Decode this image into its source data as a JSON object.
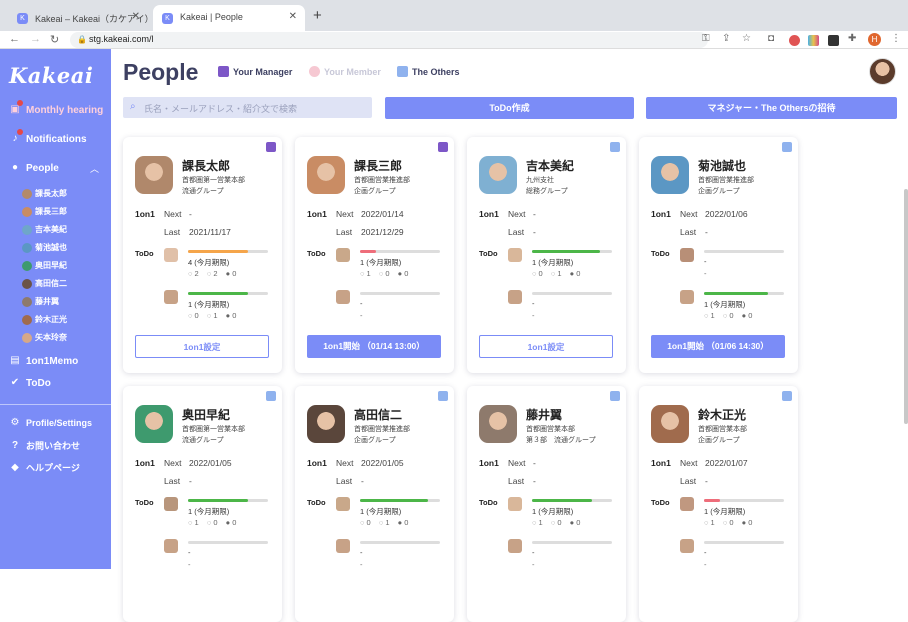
{
  "browser": {
    "tabs": [
      {
        "title": "Kakeai – Kakeai（カケアイ）| M..."
      },
      {
        "title": "Kakeai | People"
      }
    ],
    "url": "stg.kakeai.com/l",
    "profile_initial": "H"
  },
  "sidebar": {
    "logo": "Kakeai",
    "items": [
      {
        "label": "Monthly hearing"
      },
      {
        "label": "Notifications"
      },
      {
        "label": "People"
      },
      {
        "label": "1on1Memo"
      },
      {
        "label": "ToDo"
      },
      {
        "label": "Profile/Settings"
      },
      {
        "label": "お問い合わせ"
      },
      {
        "label": "ヘルプページ"
      }
    ],
    "people": [
      "課長太郎",
      "課長三郎",
      "吉本美紀",
      "菊池誠也",
      "奥田早紀",
      "高田信二",
      "藤井翼",
      "鈴木正光",
      "矢本玲奈"
    ]
  },
  "header": {
    "title": "People",
    "filters": [
      "Your Manager",
      "Your Member",
      "The Others"
    ]
  },
  "toolbar": {
    "search_placeholder": "氏名・メールアドレス・紹介文で検索",
    "todo_button": "ToDo作成",
    "invite_button": "マネジャー・The Othersの招待"
  },
  "labels": {
    "oneonone": "1on1",
    "next": "Next",
    "last": "Last",
    "todo": "ToDo"
  },
  "cards": [
    {
      "name": "課長太郎",
      "dept1": "首都圏第一営業本部",
      "dept2": "流通グループ",
      "next": "-",
      "last": "2021/11/17",
      "t1": "4 (今月期限)",
      "c1": [
        "2",
        "2",
        "0"
      ],
      "t2": "1 (今月期限)",
      "c2": [
        "0",
        "1",
        "0"
      ],
      "button": "1on1設定"
    },
    {
      "name": "課長三郎",
      "dept1": "首都圏営業推進部",
      "dept2": "企画グループ",
      "next": "2022/01/14",
      "last": "2021/12/29",
      "t1": "1 (今月期限)",
      "c1": [
        "1",
        "0",
        "0"
      ],
      "t2": "-",
      "c2": [],
      "button": "1on1開始 （01/14 13:00）"
    },
    {
      "name": "吉本美紀",
      "dept1": "九州支社",
      "dept2": "総務グループ",
      "next": "-",
      "last": "-",
      "t1": "1 (今月期限)",
      "c1": [
        "0",
        "1",
        "0"
      ],
      "t2": "-",
      "c2": [],
      "button": "1on1設定"
    },
    {
      "name": "菊池誠也",
      "dept1": "首都圏営業推進部",
      "dept2": "企画グループ",
      "next": "2022/01/06",
      "last": "-",
      "t1": "-",
      "c1": [],
      "t2": "1 (今月期限)",
      "c2": [
        "1",
        "0",
        "0"
      ],
      "button": "1on1開始 （01/06 14:30）"
    },
    {
      "name": "奥田早紀",
      "dept1": "首都圏第一営業本部",
      "dept2": "流通グループ",
      "next": "2022/01/05",
      "last": "-",
      "t1": "1 (今月期限)",
      "c1": [
        "1",
        "0",
        "0"
      ],
      "t2": "-",
      "c2": [],
      "button": ""
    },
    {
      "name": "高田信二",
      "dept1": "首都圏営業推進部",
      "dept2": "企画グループ",
      "next": "2022/01/05",
      "last": "-",
      "t1": "1 (今月期限)",
      "c1": [
        "0",
        "1",
        "0"
      ],
      "t2": "-",
      "c2": [],
      "button": ""
    },
    {
      "name": "藤井翼",
      "dept1": "首都圏営業本部",
      "dept2": "第３部　流通グループ",
      "next": "-",
      "last": "-",
      "t1": "1 (今月期限)",
      "c1": [
        "1",
        "0",
        "0"
      ],
      "t2": "-",
      "c2": [],
      "button": ""
    },
    {
      "name": "鈴木正光",
      "dept1": "首都圏営業本部",
      "dept2": "企画グループ",
      "next": "2022/01/07",
      "last": "-",
      "t1": "1 (今月期限)",
      "c1": [
        "1",
        "0",
        "0"
      ],
      "t2": "-",
      "c2": [],
      "button": ""
    }
  ],
  "colors": {
    "accent": "#7b8cf7",
    "manager_badge": "#7d57c7",
    "others_badge": "#8fb2ee",
    "bar_orange": "#f5a54a",
    "bar_green": "#4cb648",
    "bar_red": "#ee6d7a"
  }
}
